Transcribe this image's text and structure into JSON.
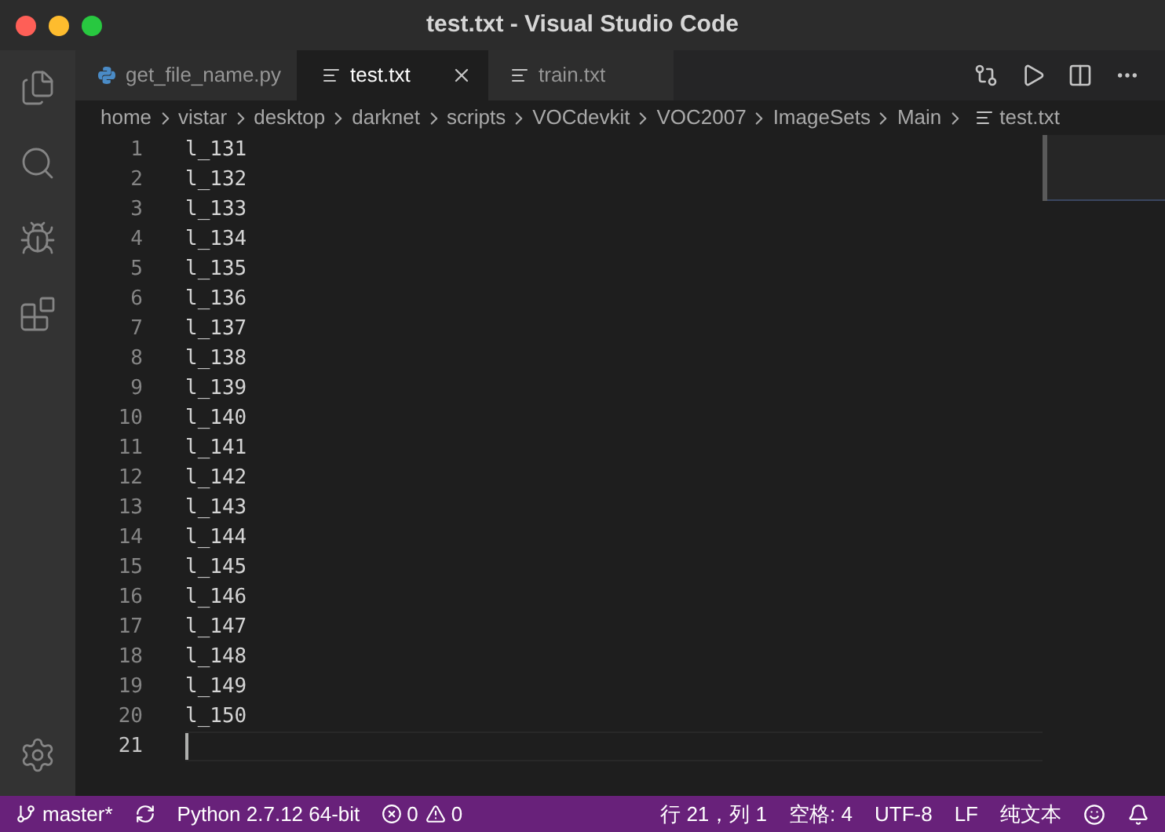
{
  "window": {
    "title": "test.txt - Visual Studio Code"
  },
  "tabs": [
    {
      "label": "get_file_name.py",
      "kind": "python",
      "selected": false
    },
    {
      "label": "test.txt",
      "kind": "text",
      "selected": true
    },
    {
      "label": "train.txt",
      "kind": "text",
      "selected": false
    }
  ],
  "breadcrumbs": [
    "home",
    "vistar",
    "desktop",
    "darknet",
    "scripts",
    "VOCdevkit",
    "VOC2007",
    "ImageSets",
    "Main",
    "test.txt"
  ],
  "editor": {
    "lines": [
      {
        "number": "1",
        "text": "l_131",
        "current": false
      },
      {
        "number": "2",
        "text": "l_132",
        "current": false
      },
      {
        "number": "3",
        "text": "l_133",
        "current": false
      },
      {
        "number": "4",
        "text": "l_134",
        "current": false
      },
      {
        "number": "5",
        "text": "l_135",
        "current": false
      },
      {
        "number": "6",
        "text": "l_136",
        "current": false
      },
      {
        "number": "7",
        "text": "l_137",
        "current": false
      },
      {
        "number": "8",
        "text": "l_138",
        "current": false
      },
      {
        "number": "9",
        "text": "l_139",
        "current": false
      },
      {
        "number": "10",
        "text": "l_140",
        "current": false
      },
      {
        "number": "11",
        "text": "l_141",
        "current": false
      },
      {
        "number": "12",
        "text": "l_142",
        "current": false
      },
      {
        "number": "13",
        "text": "l_143",
        "current": false
      },
      {
        "number": "14",
        "text": "l_144",
        "current": false
      },
      {
        "number": "15",
        "text": "l_145",
        "current": false
      },
      {
        "number": "16",
        "text": "l_146",
        "current": false
      },
      {
        "number": "17",
        "text": "l_147",
        "current": false
      },
      {
        "number": "18",
        "text": "l_148",
        "current": false
      },
      {
        "number": "19",
        "text": "l_149",
        "current": false
      },
      {
        "number": "20",
        "text": "l_150",
        "current": false
      },
      {
        "number": "21",
        "current": true
      }
    ]
  },
  "status_bar": {
    "branch": "master*",
    "interpreter": "Python 2.7.12 64-bit",
    "errors": "0",
    "warnings": "0",
    "position": "行 21，列 1",
    "indent": "空格: 4",
    "encoding": "UTF-8",
    "eol": "LF",
    "language": "纯文本"
  }
}
